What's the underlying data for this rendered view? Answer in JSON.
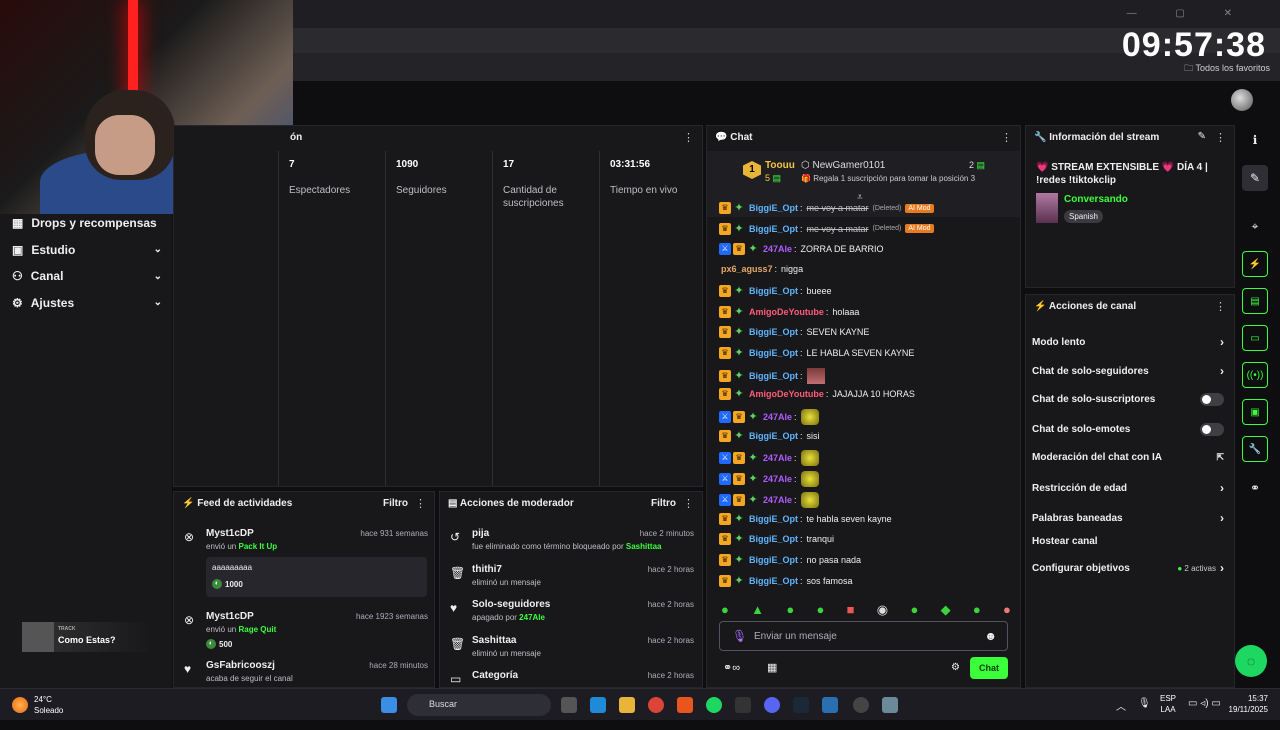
{
  "clock": "09:57:38",
  "browser": {
    "favorites": "Todos los favoritos"
  },
  "sidebar": {
    "items": [
      {
        "label": "Drops y recompensas",
        "icon": "drops-icon",
        "chevron": false
      },
      {
        "label": "Estudio",
        "icon": "studio-icon",
        "chevron": true
      },
      {
        "label": "Canal",
        "icon": "channel-icon",
        "chevron": true
      },
      {
        "label": "Ajustes",
        "icon": "gear-icon",
        "chevron": true
      }
    ]
  },
  "now_playing": {
    "label": "TRACK",
    "title": "Como Estas?"
  },
  "stats": {
    "title_fragment": "ón",
    "cols": [
      {
        "value": "7",
        "label": "Espectadores"
      },
      {
        "value": "1090",
        "label": "Seguidores"
      },
      {
        "value": "17",
        "label": "Cantidad de suscripciones"
      },
      {
        "value": "03:31:56",
        "label": "Tiempo en vivo"
      }
    ]
  },
  "feed": {
    "title": "Feed de actividades",
    "filter": "Filtro",
    "items": [
      {
        "name": "Myst1cDP",
        "time": "hace 931 semanas",
        "action": "envió un",
        "reward": "Pack It Up",
        "message": "aaaaaaaaa",
        "points": "1000"
      },
      {
        "name": "Myst1cDP",
        "time": "hace 1923 semanas",
        "action": "envió un",
        "reward": "Rage Quit",
        "points": "500"
      },
      {
        "name": "GsFabricooszj",
        "time": "hace 28 minutos",
        "action": "acaba de seguir el canal"
      }
    ]
  },
  "mod": {
    "title": "Acciones de moderador",
    "filter": "Filtro",
    "items": [
      {
        "name": "pija",
        "time": "hace 2 minutos",
        "desc": "fue eliminado como término bloqueado por",
        "by": "Sashittaa"
      },
      {
        "name": "thithi7",
        "time": "hace 2 horas",
        "desc": "eliminó un mensaje"
      },
      {
        "name": "Solo-seguidores",
        "time": "hace 2 horas",
        "desc": "apagado por",
        "by": "247Ale"
      },
      {
        "name": "Sashittaa",
        "time": "hace 2 horas",
        "desc": "eliminó un mensaje"
      },
      {
        "name": "Categoría",
        "time": "hace 2 horas"
      }
    ]
  },
  "chat": {
    "title": "Chat",
    "pinned": {
      "rank": "1",
      "user1": "Toouu",
      "count1": "5",
      "user2": "NewGamer0101",
      "count2": "2",
      "gift": "Regala 1 suscripción para tomar la posición 3"
    },
    "messages": [
      {
        "user": "BiggiE_Opt",
        "color": "#5fb6ff",
        "text": "me voy a matar",
        "deleted": true,
        "note": "(Deleted)",
        "tag": "AI Mod",
        "badges": [
          "crown",
          "star"
        ]
      },
      {
        "user": "BiggiE_Opt",
        "color": "#5fb6ff",
        "text": "me voy a matar",
        "deleted": true,
        "note": "(Deleted)",
        "tag": "AI Mod",
        "badges": [
          "crown",
          "star"
        ]
      },
      {
        "user": "247Ale",
        "color": "#b05cff",
        "text": "ZORRA DE BARRIO",
        "badges": [
          "mod",
          "crown",
          "star"
        ]
      },
      {
        "user": "px6_aguss7",
        "color": "#e6a96a",
        "text": "nigga",
        "badges": []
      },
      {
        "user": "BiggiE_Opt",
        "color": "#5fb6ff",
        "text": "bueee",
        "badges": [
          "crown",
          "star"
        ]
      },
      {
        "user": "AmigoDeYoutube",
        "color": "#ff5c7a",
        "text": "holaaa",
        "badges": [
          "crown",
          "star"
        ]
      },
      {
        "user": "BiggiE_Opt",
        "color": "#5fb6ff",
        "text": "SEVEN KAYNE",
        "badges": [
          "crown",
          "star"
        ]
      },
      {
        "user": "BiggiE_Opt",
        "color": "#5fb6ff",
        "text": "LE HABLA SEVEN KAYNE",
        "badges": [
          "crown",
          "star"
        ]
      },
      {
        "user": "BiggiE_Opt",
        "color": "#5fb6ff",
        "text": "",
        "emote": "emote2",
        "badges": [
          "crown",
          "star"
        ]
      },
      {
        "user": "AmigoDeYoutube",
        "color": "#ff5c7a",
        "text": "JAJAJJA 10 HORAS",
        "badges": [
          "crown",
          "star"
        ]
      },
      {
        "user": "247Ale",
        "color": "#b05cff",
        "text": "",
        "emote": "emote",
        "badges": [
          "mod",
          "crown",
          "star"
        ]
      },
      {
        "user": "BiggiE_Opt",
        "color": "#5fb6ff",
        "text": "sisi",
        "badges": [
          "crown",
          "star"
        ]
      },
      {
        "user": "247Ale",
        "color": "#b05cff",
        "text": "",
        "emote": "emote",
        "badges": [
          "mod",
          "crown",
          "star"
        ]
      },
      {
        "user": "247Ale",
        "color": "#b05cff",
        "text": "",
        "emote": "emote",
        "badges": [
          "mod",
          "crown",
          "star"
        ]
      },
      {
        "user": "247Ale",
        "color": "#b05cff",
        "text": "",
        "emote": "emote",
        "badges": [
          "mod",
          "crown",
          "star"
        ]
      },
      {
        "user": "BiggiE_Opt",
        "color": "#5fb6ff",
        "text": "te habla seven kayne",
        "badges": [
          "crown",
          "star"
        ]
      },
      {
        "user": "BiggiE_Opt",
        "color": "#5fb6ff",
        "text": "tranqui",
        "badges": [
          "crown",
          "star"
        ]
      },
      {
        "user": "BiggiE_Opt",
        "color": "#5fb6ff",
        "text": "no pasa nada",
        "badges": [
          "crown",
          "star"
        ]
      },
      {
        "user": "BiggiE_Opt",
        "color": "#5fb6ff",
        "text": "sos famosa",
        "badges": [
          "crown",
          "star"
        ]
      }
    ],
    "placeholder": "Enviar un mensaje",
    "send": "Chat"
  },
  "info": {
    "title": "Información del stream",
    "stream_title": "💗 STREAM EXTENSIBLE 💗 DÍA 4 | !redes !tiktokclip",
    "category": "Conversando",
    "language": "Spanish"
  },
  "actions": {
    "title": "Acciones de canal",
    "items": [
      {
        "label": "Modo lento",
        "control": "chevron"
      },
      {
        "label": "Chat de solo-seguidores",
        "control": "chevron"
      },
      {
        "label": "Chat de solo-suscriptores",
        "control": "toggle"
      },
      {
        "label": "Chat de solo-emotes",
        "control": "toggle"
      },
      {
        "label": "Moderación del chat con IA",
        "control": "external"
      },
      {
        "label": "Restricción de edad",
        "control": "chevron"
      },
      {
        "label": "Palabras baneadas",
        "control": "chevron"
      },
      {
        "label": "Hostear canal",
        "control": "none"
      },
      {
        "label": "Configurar objetivos",
        "control": "chevron",
        "extra": "2 activas"
      }
    ]
  },
  "taskbar": {
    "temp": "24°C",
    "weather": "Soleado",
    "search": "Buscar",
    "lang1": "ESP",
    "lang2": "LAA",
    "time": "15:37",
    "date": "19/11/2025"
  },
  "colors": {
    "accent": "#3cff3c",
    "bg": "#0e0e10",
    "panel": "#18181b"
  }
}
